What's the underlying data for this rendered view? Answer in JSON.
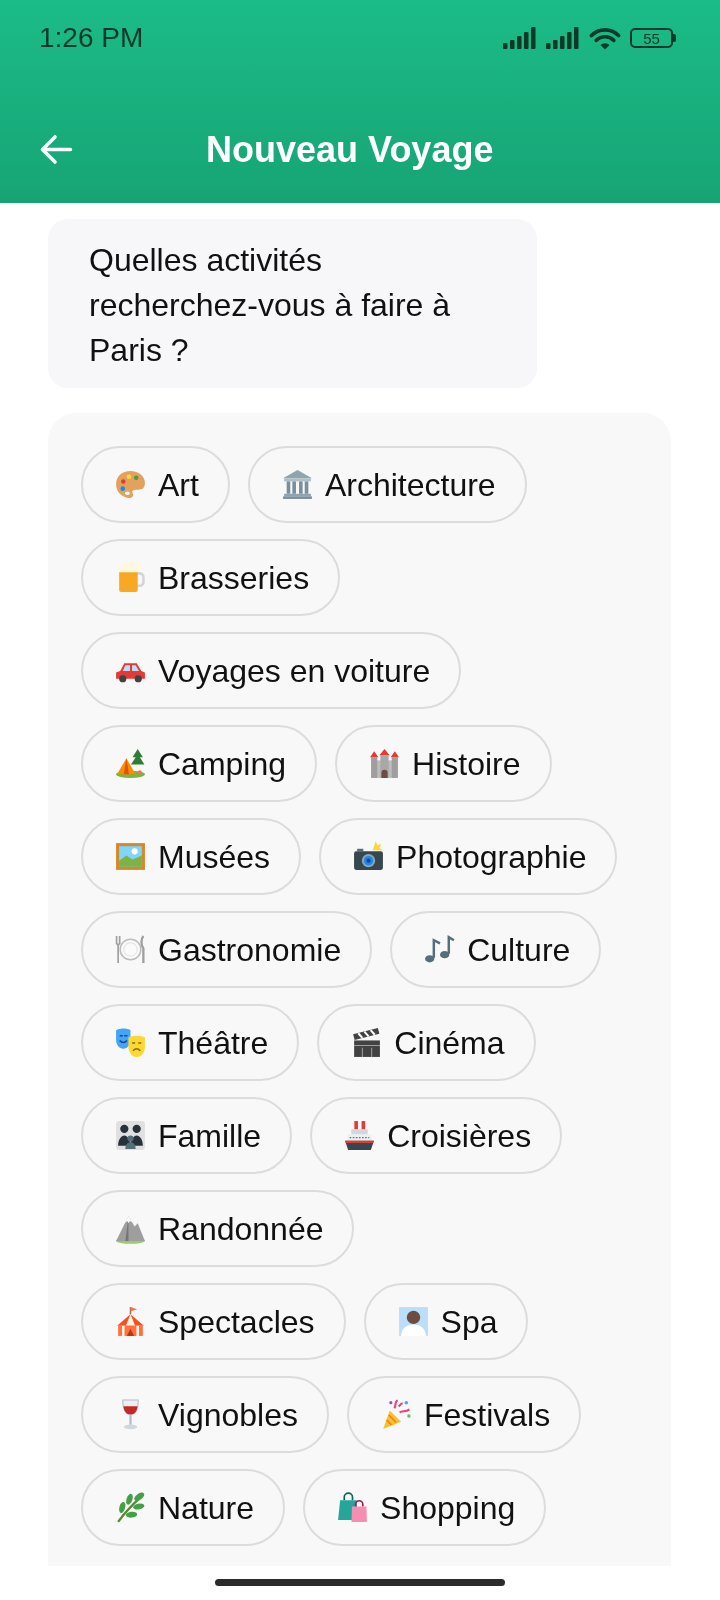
{
  "status_bar": {
    "time": "1:26 PM",
    "battery": "55"
  },
  "header": {
    "title": "Nouveau Voyage"
  },
  "question": {
    "text": "Quelles activités recherchez-vous à faire à Paris ?"
  },
  "activity_rows": [
    {
      "chips": [
        {
          "kind": "palette",
          "label": "Art",
          "selected": false
        },
        {
          "kind": "building",
          "label": "Architecture",
          "selected": false
        }
      ]
    },
    {
      "chips": [
        {
          "kind": "beer",
          "label": "Brasseries",
          "selected": false
        }
      ]
    },
    {
      "chips": [
        {
          "kind": "car",
          "label": "Voyages en voiture",
          "selected": false
        }
      ]
    },
    {
      "chips": [
        {
          "kind": "camping",
          "label": "Camping",
          "selected": false
        },
        {
          "kind": "castle",
          "label": "Histoire",
          "selected": false
        }
      ]
    },
    {
      "chips": [
        {
          "kind": "picture",
          "label": "Musées",
          "selected": false
        },
        {
          "kind": "camera",
          "label": "Photographie",
          "selected": false
        }
      ]
    },
    {
      "chips": [
        {
          "kind": "dining",
          "label": "Gastronomie",
          "selected": false
        },
        {
          "kind": "music",
          "label": "Culture",
          "selected": false
        }
      ]
    },
    {
      "chips": [
        {
          "kind": "masks",
          "label": "Théâtre",
          "selected": false
        },
        {
          "kind": "clapper",
          "label": "Cinéma",
          "selected": false
        }
      ]
    },
    {
      "chips": [
        {
          "kind": "family",
          "label": "Famille",
          "selected": false
        },
        {
          "kind": "ship",
          "label": "Croisières",
          "selected": false
        }
      ]
    },
    {
      "chips": [
        {
          "kind": "mountain",
          "label": "Randonnée",
          "selected": false
        }
      ]
    },
    {
      "chips": [
        {
          "kind": "circus",
          "label": "Spectacles",
          "selected": false
        },
        {
          "kind": "spa",
          "label": "Spa",
          "selected": false
        }
      ]
    },
    {
      "chips": [
        {
          "kind": "wine",
          "label": "Vignobles",
          "selected": false
        },
        {
          "kind": "party",
          "label": "Festivals",
          "selected": false
        }
      ]
    },
    {
      "chips": [
        {
          "kind": "herb",
          "label": "Nature",
          "selected": false
        },
        {
          "kind": "shopping",
          "label": "Shopping",
          "selected": false
        }
      ]
    }
  ]
}
